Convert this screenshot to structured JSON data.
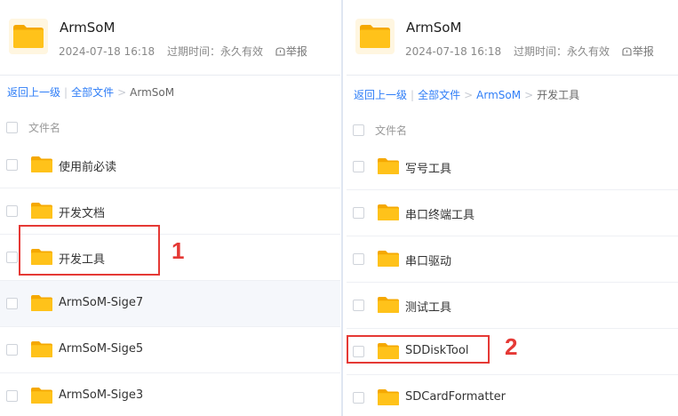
{
  "left_panel": {
    "title": "ArmSoM",
    "date": "2024-07-18 16:18",
    "expire": "过期时间：永久有效",
    "report": "举报",
    "breadcrumb": {
      "back": "返回上一级",
      "all": "全部文件",
      "current": "ArmSoM"
    },
    "column_header": "文件名",
    "items": [
      {
        "name": "使用前必读"
      },
      {
        "name": "开发文档"
      },
      {
        "name": "开发工具"
      },
      {
        "name": "ArmSoM-Sige7"
      },
      {
        "name": "ArmSoM-Sige5"
      },
      {
        "name": "ArmSoM-Sige3"
      }
    ],
    "annotation": "1"
  },
  "right_panel": {
    "title": "ArmSoM",
    "date": "2024-07-18 16:18",
    "expire": "过期时间：永久有效",
    "report": "举报",
    "breadcrumb": {
      "back": "返回上一级",
      "all": "全部文件",
      "parent": "ArmSoM",
      "current": "开发工具"
    },
    "column_header": "文件名",
    "items": [
      {
        "name": "写号工具"
      },
      {
        "name": "串口终端工具"
      },
      {
        "name": "串口驱动"
      },
      {
        "name": "测试工具"
      },
      {
        "name": "SDDiskTool"
      },
      {
        "name": "SDCardFormatter"
      }
    ],
    "annotation": "2"
  },
  "colors": {
    "accent": "#2f7ef7",
    "folder": "#ffc21a",
    "highlight": "#e53935"
  },
  "icons": [
    "folder-icon",
    "report-icon"
  ]
}
